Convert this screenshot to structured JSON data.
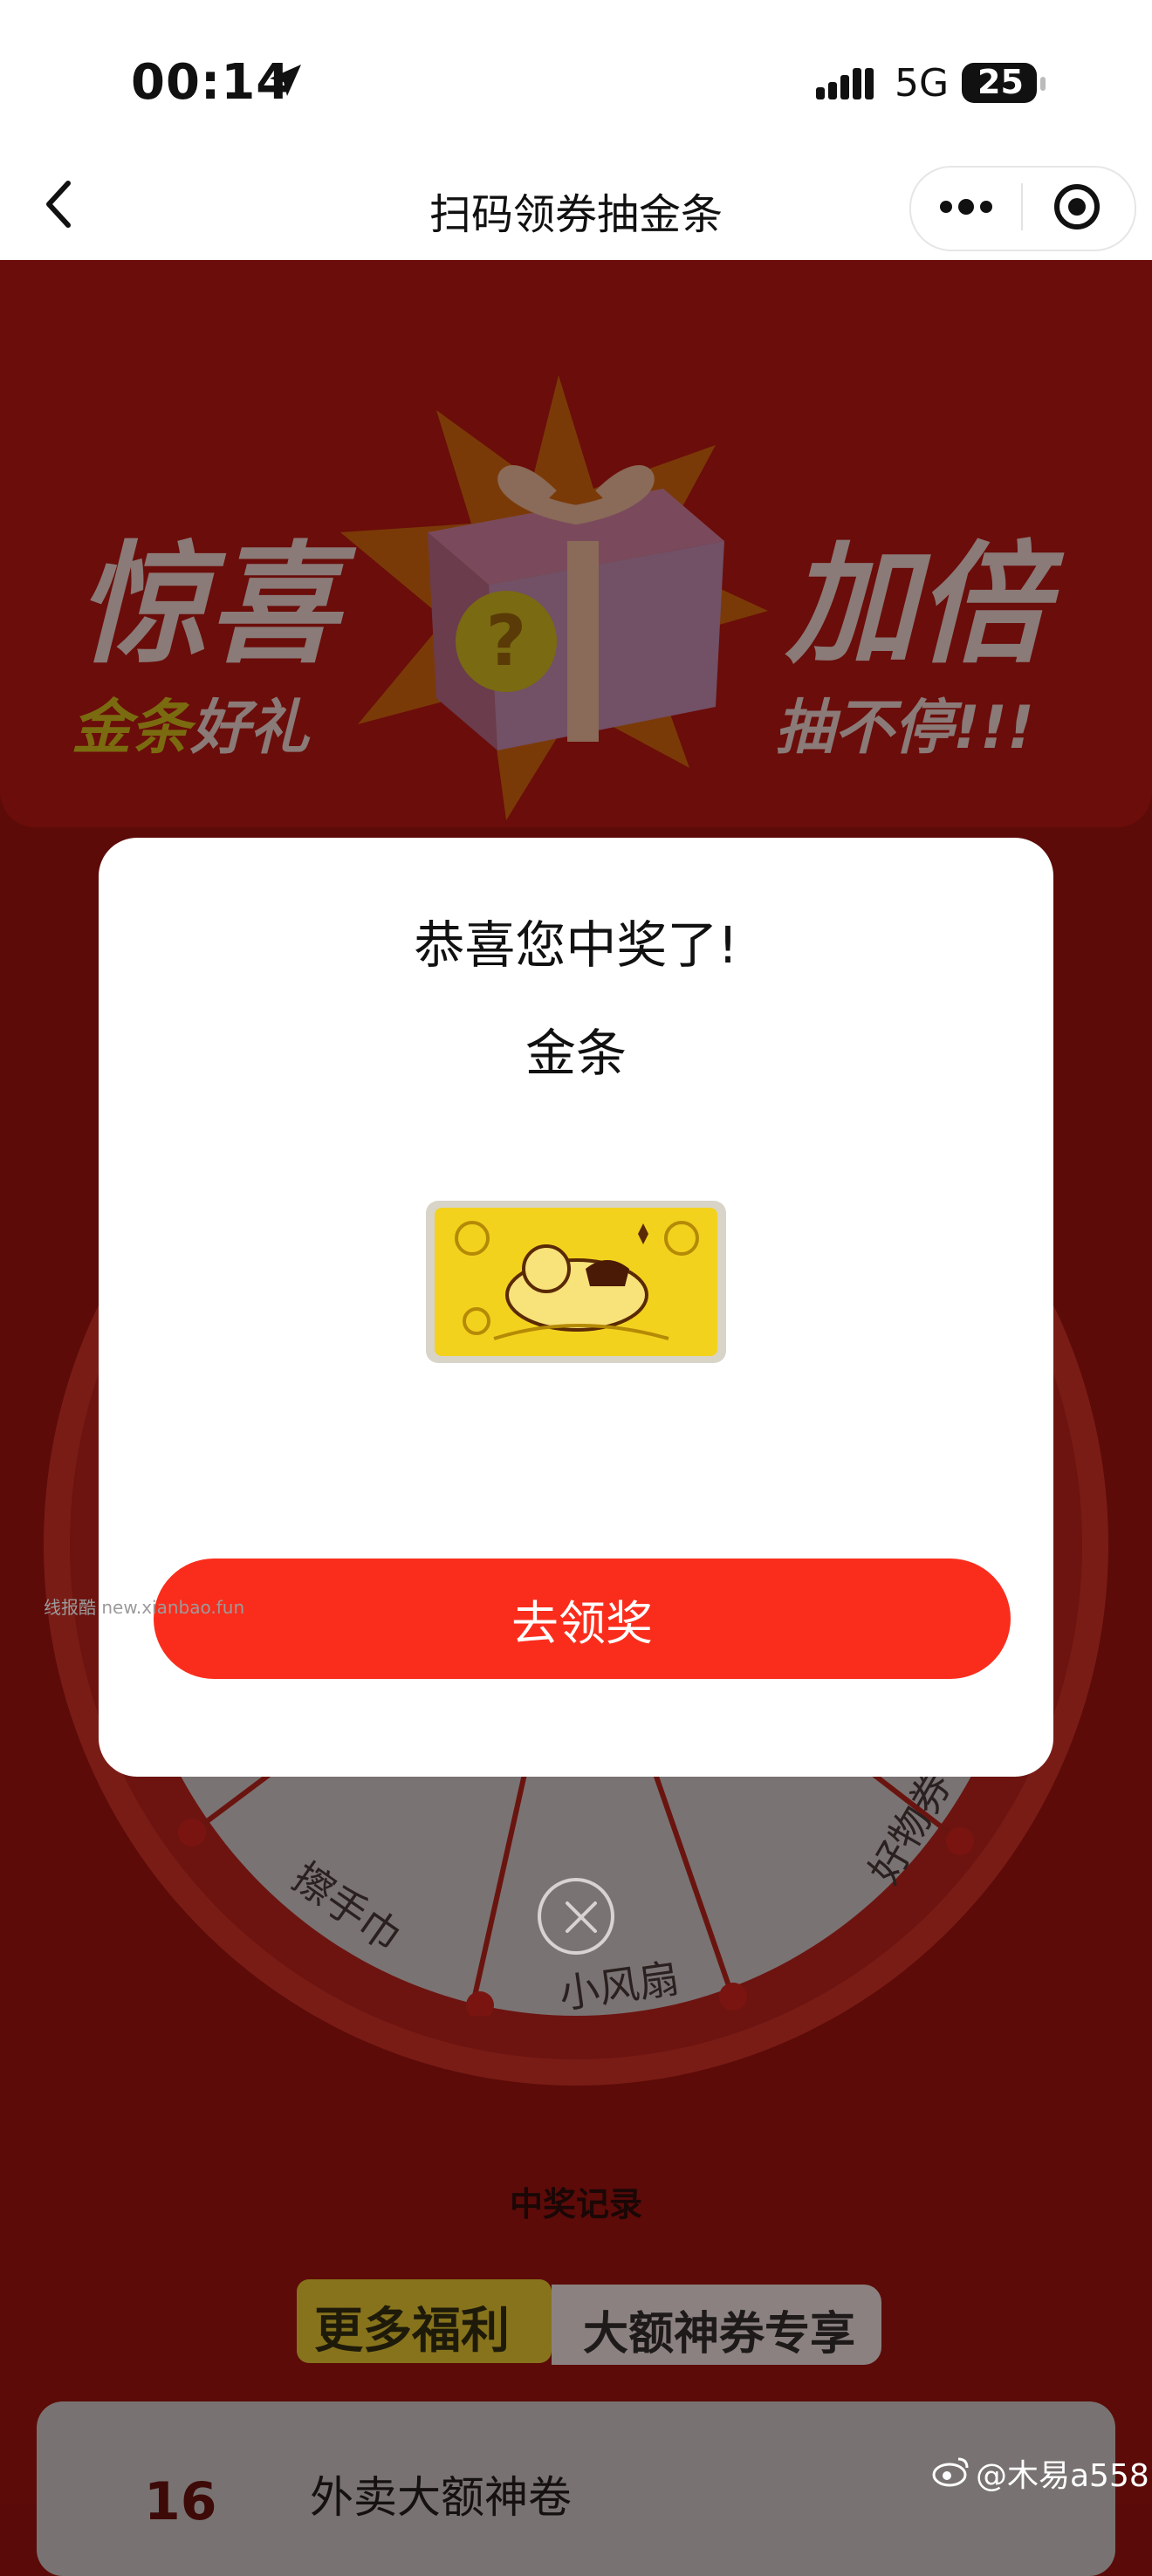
{
  "status_bar": {
    "time": "00:14",
    "network": "5G",
    "battery": "25"
  },
  "nav": {
    "title": "扫码领券抽金条"
  },
  "banner": {
    "left_big": "惊喜",
    "left_small_gold": "金条",
    "left_small_rest": "好礼",
    "right_big": "加倍",
    "right_small": "抽不停!!!"
  },
  "wheel": {
    "labels": [
      "擦手巾",
      "小风扇",
      "好物券包"
    ]
  },
  "modal": {
    "title": "恭喜您中奖了!",
    "prize_name": "金条",
    "claim_label": "去领奖",
    "watermark": "线报酷 new.xianbao.fun"
  },
  "record_label": "中奖记录",
  "more": {
    "tag": "更多福利",
    "text": "大额神券专享"
  },
  "coupon": {
    "number": "16",
    "title": "外卖大额神卷"
  },
  "attribution": "@木易a558",
  "colors": {
    "claim_button": "#fa2d1c",
    "backdrop": "#5c0b08",
    "gold": "#f3d21e"
  }
}
